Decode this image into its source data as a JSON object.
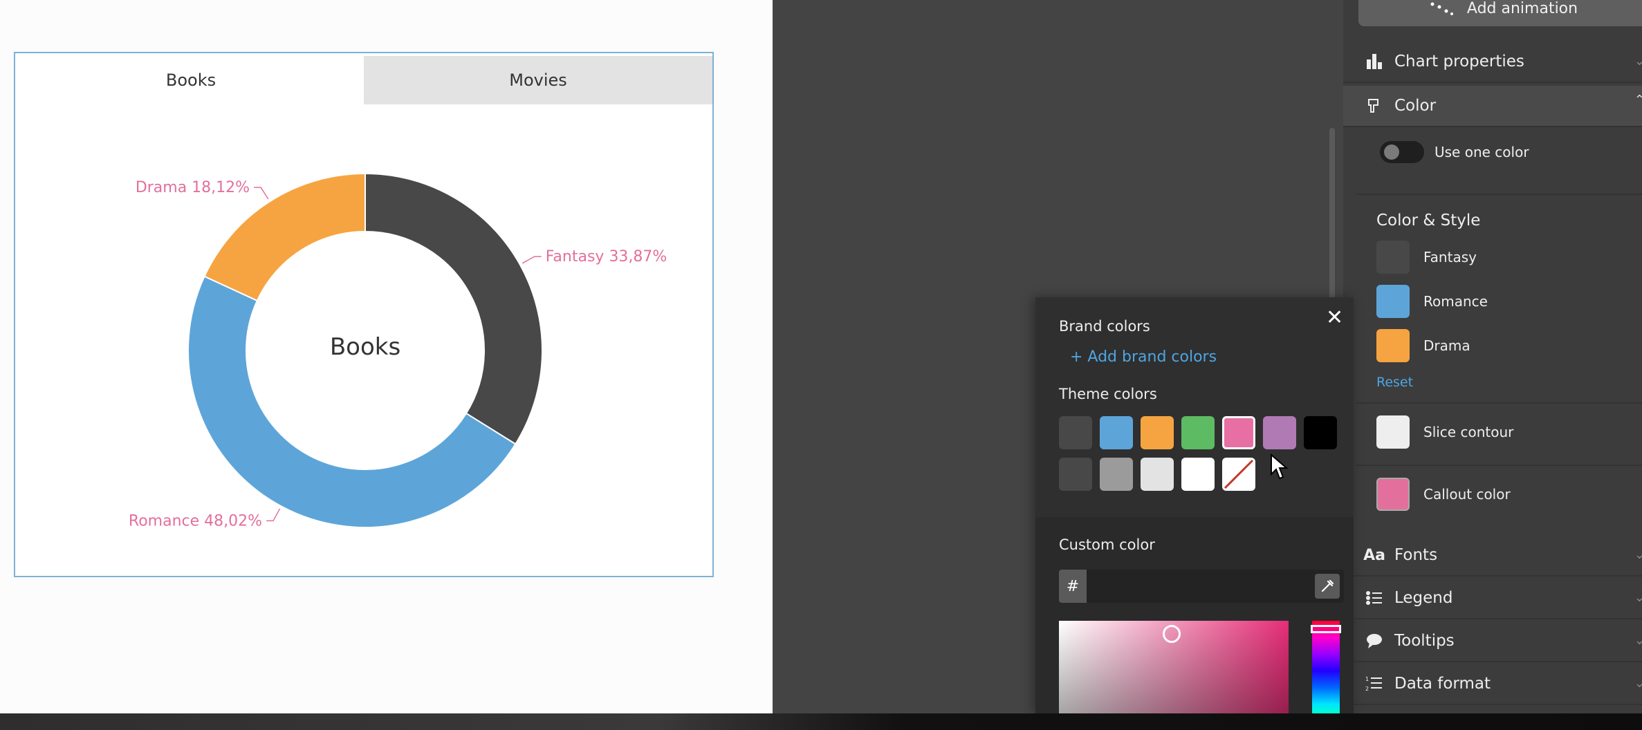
{
  "tabs": [
    {
      "label": "Books",
      "active": true
    },
    {
      "label": "Movies",
      "active": false
    }
  ],
  "chart_data": {
    "type": "pie",
    "variant": "donut",
    "title": "Books",
    "categories": [
      "Fantasy",
      "Romance",
      "Drama"
    ],
    "values": [
      33.87,
      48.02,
      18.12
    ],
    "colors": [
      "#484848",
      "#5da5d9",
      "#f6a441"
    ],
    "labels": [
      "Fantasy 33,87%",
      "Romance 48,02%",
      "Drama 18,12%"
    ],
    "label_color": "#e36f9c"
  },
  "right_panel": {
    "add_animation": "Add animation",
    "sections": {
      "chart_properties": "Chart properties",
      "color": "Color",
      "fonts": "Fonts",
      "legend": "Legend",
      "tooltips": "Tooltips",
      "data_format": "Data format"
    },
    "use_one_color": "Use one color",
    "color_style_title": "Color & Style",
    "series_colors": [
      {
        "name": "Fantasy",
        "color": "#484848"
      },
      {
        "name": "Romance",
        "color": "#5da5d9"
      },
      {
        "name": "Drama",
        "color": "#f6a441"
      }
    ],
    "reset": "Reset",
    "slice_contour": {
      "label": "Slice contour",
      "color": "#eeeeee"
    },
    "callout_color": {
      "label": "Callout color",
      "color": "#e36f9c"
    }
  },
  "color_picker": {
    "brand_title": "Brand colors",
    "add_brand": "+ Add brand colors",
    "theme_title": "Theme colors",
    "theme_colors": [
      "#484848",
      "#5da5d9",
      "#f6a441",
      "#5dbb63",
      "#e86fa4",
      "#b07ab5",
      "#000000",
      "#484848",
      "#9b9b9b",
      "#e3e3e3",
      "#ffffff",
      "none"
    ],
    "selected_theme_color": "#e86fa4",
    "custom_title": "Custom color",
    "hash": "#",
    "hex_value": ""
  }
}
